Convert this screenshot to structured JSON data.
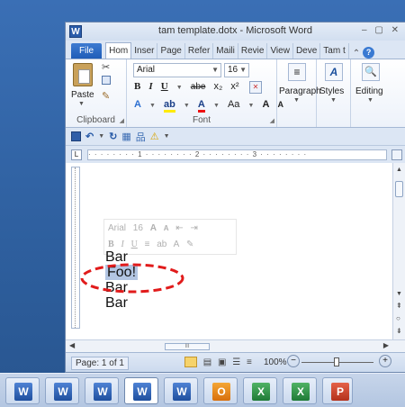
{
  "window": {
    "title": "tam template.dotx - Microsoft Word",
    "controls": "– ▢ ✕",
    "app_icon": "W"
  },
  "tabs": [
    {
      "label": "File"
    },
    {
      "label": "Hom"
    },
    {
      "label": "Inser"
    },
    {
      "label": "Page"
    },
    {
      "label": "Refer"
    },
    {
      "label": "Maili"
    },
    {
      "label": "Revie"
    },
    {
      "label": "View"
    },
    {
      "label": "Deve"
    },
    {
      "label": "Tam t"
    }
  ],
  "ribbon": {
    "clipboard": {
      "paste_label": "Paste",
      "group_label": "Clipboard"
    },
    "font": {
      "font_name": "Arial",
      "font_size": "16",
      "group_label": "Font",
      "bold": "B",
      "italic": "I",
      "underline": "U",
      "strikethrough": "abe",
      "subscript": "x₂",
      "superscript": "x²",
      "grow_font": "A",
      "shrink_font": "A",
      "change_case": "Aa"
    },
    "paragraph": {
      "label": "Paragraph",
      "icon": "≡"
    },
    "styles": {
      "label": "Styles",
      "icon": "A"
    },
    "editing": {
      "label": "Editing",
      "icon": "🔍"
    }
  },
  "mini_toolbar": {
    "font_name": "Arial",
    "font_size": "16",
    "grow": "A",
    "shrink": "A",
    "bold": "B",
    "italic": "I",
    "underline": "U"
  },
  "document": {
    "lines": [
      {
        "text": "Bar",
        "selected": false
      },
      {
        "text": "Foo!",
        "selected": true
      },
      {
        "text": "Bar",
        "selected": false
      },
      {
        "text": "Bar",
        "selected": false
      }
    ],
    "highlight_color": "#e11b1b"
  },
  "status_bar": {
    "page_count": "Page: 1 of 1",
    "zoom": "100%"
  },
  "ruler": {
    "marks": "· · · · · · · · 1 · · · · · · · · 2 · · · · · · · · 3 · · · · · · · ·"
  },
  "taskbar": {
    "items": [
      {
        "app": "word-icon",
        "letter": "W"
      },
      {
        "app": "word-icon",
        "letter": "W"
      },
      {
        "app": "word-icon",
        "letter": "W"
      },
      {
        "app": "word-icon",
        "letter": "W",
        "active": true
      },
      {
        "app": "word-icon",
        "letter": "W"
      },
      {
        "app": "outlook-icon",
        "letter": "O"
      },
      {
        "app": "excel-icon",
        "letter": "X"
      },
      {
        "app": "excel-icon",
        "letter": "X"
      },
      {
        "app": "powerpoint-icon",
        "letter": "P"
      }
    ]
  }
}
